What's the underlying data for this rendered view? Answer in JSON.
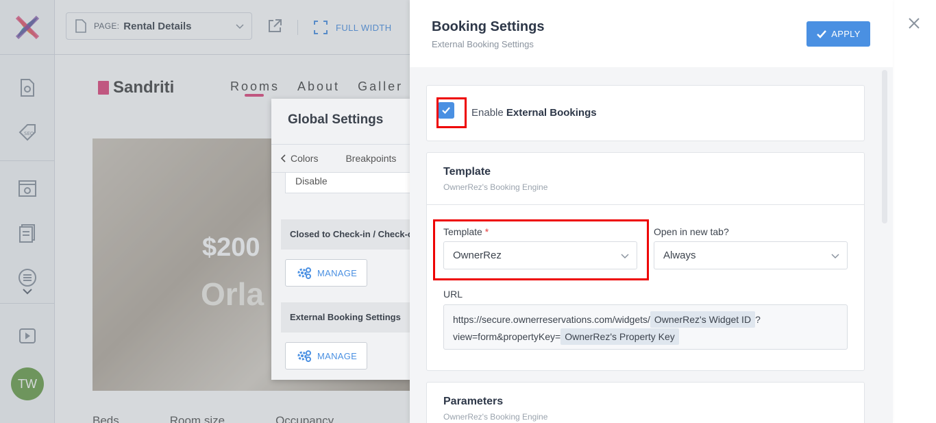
{
  "topbar": {
    "page_label": "PAGE:",
    "page_value": "Rental Details",
    "full_width_label": "FULL WIDTH"
  },
  "sidebar": {
    "avatar_initials": "TW"
  },
  "preview": {
    "brand": "Sandriti",
    "nav": [
      "Rooms",
      "About",
      "Galler"
    ],
    "price": "$200",
    "city": "Orla",
    "stats": [
      "Beds",
      "Room size",
      "Occupancy"
    ]
  },
  "global_settings": {
    "title": "Global Settings",
    "tabs": [
      "Colors",
      "Breakpoints"
    ],
    "disable_value": "Disable",
    "sections": [
      {
        "label": "Closed to Check-in / Check-out",
        "manage": "MANAGE"
      },
      {
        "label": "External Booking Settings",
        "manage": "MANAGE"
      }
    ]
  },
  "panel": {
    "title": "Booking Settings",
    "subtitle": "External Booking Settings",
    "apply_label": "APPLY",
    "enable_label_prefix": "Enable",
    "enable_label_strong": "External Bookings",
    "enable_checked": true,
    "template_card": {
      "title": "Template",
      "subtitle": "OwnerRez's Booking Engine",
      "template_field_label": "Template",
      "required_mark": "*",
      "template_value": "OwnerRez",
      "new_tab_label": "Open in new tab?",
      "new_tab_value": "Always",
      "url_label": "URL",
      "url_part1": "https://secure.ownerreservations.com/widgets/",
      "url_tag1": "OwnerRez's Widget ID",
      "url_part2": "?",
      "url_part3": "view=form&propertyKey=",
      "url_tag2": "OwnerRez's Property Key"
    },
    "parameters_card": {
      "title": "Parameters",
      "subtitle": "OwnerRez's Booking Engine"
    }
  },
  "colors": {
    "accent": "#4a90e2",
    "highlight": "#ee0000",
    "brand_pink": "#e0457b",
    "avatar": "#6a9e49"
  }
}
